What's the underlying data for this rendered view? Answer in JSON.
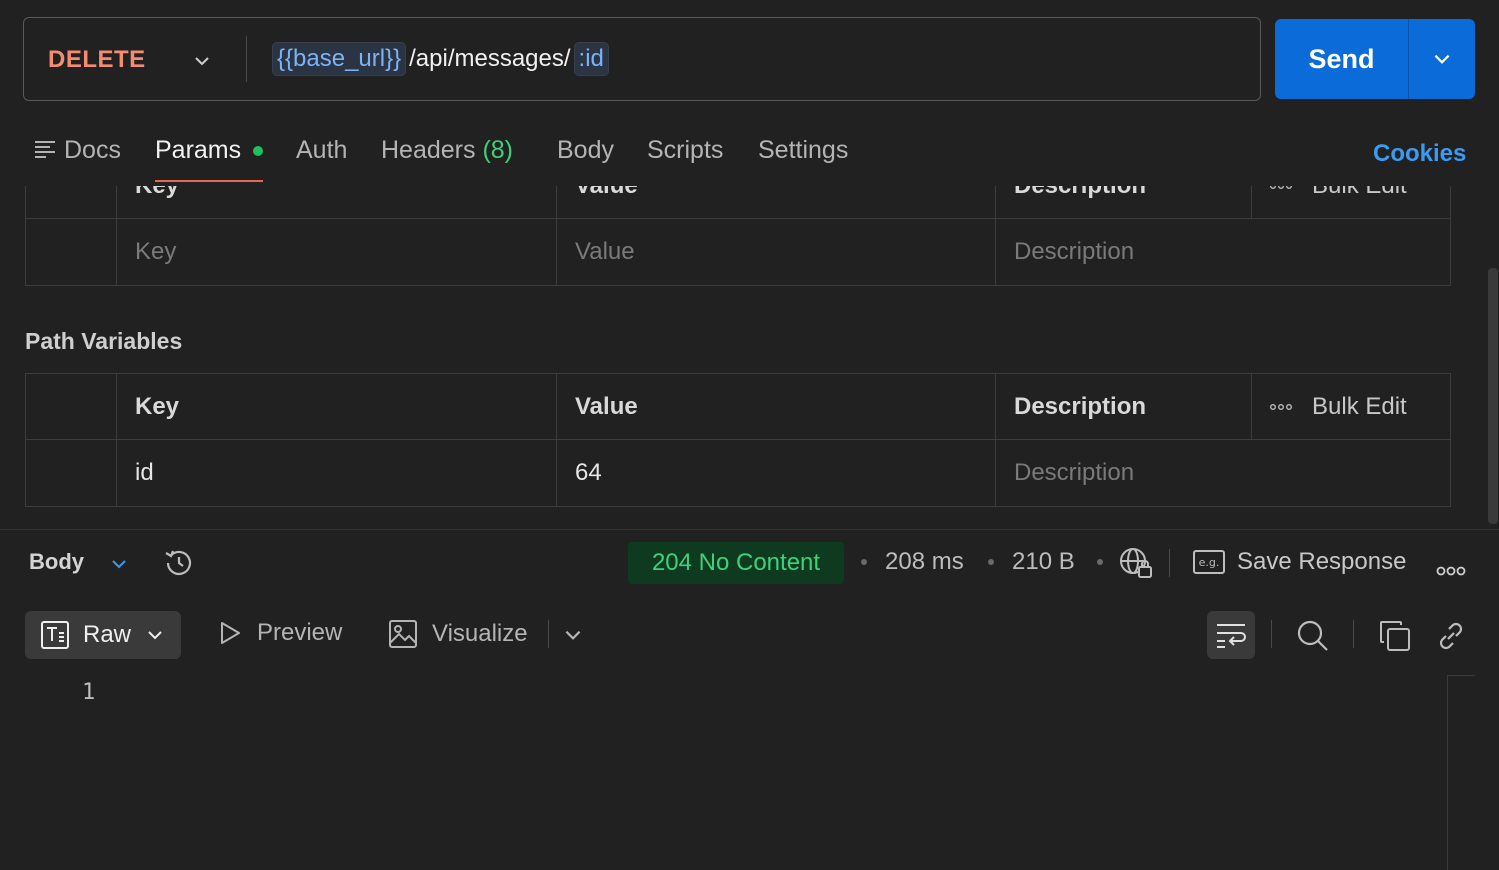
{
  "request": {
    "method": "DELETE",
    "url_var": "{{base_url}}",
    "url_path": "/api/messages/",
    "url_param": ":id",
    "send_label": "Send"
  },
  "tabs": {
    "docs": "Docs",
    "params": "Params",
    "auth": "Auth",
    "headers": "Headers",
    "headers_count": "(8)",
    "body": "Body",
    "scripts": "Scripts",
    "settings": "Settings",
    "cookies": "Cookies"
  },
  "query_params": {
    "headers": [
      "Key",
      "Value",
      "Description"
    ],
    "bulk_edit": "Bulk Edit",
    "placeholders": {
      "key": "Key",
      "value": "Value",
      "description": "Description"
    }
  },
  "path_variables": {
    "title": "Path Variables",
    "headers": [
      "Key",
      "Value",
      "Description"
    ],
    "bulk_edit": "Bulk Edit",
    "rows": [
      {
        "key": "id",
        "value": "64",
        "description_placeholder": "Description"
      }
    ]
  },
  "response": {
    "body_label": "Body",
    "status": "204 No Content",
    "time": "208 ms",
    "size": "210 B",
    "save_response": "Save Response",
    "views": {
      "raw": "Raw",
      "preview": "Preview",
      "visualize": "Visualize"
    },
    "line_number": "1"
  },
  "colors": {
    "method": "#f48b72",
    "send": "#0b6bd8",
    "accent_underline": "#e8684a",
    "status_ok": "#3fd07a",
    "link": "#3b9bf2"
  }
}
